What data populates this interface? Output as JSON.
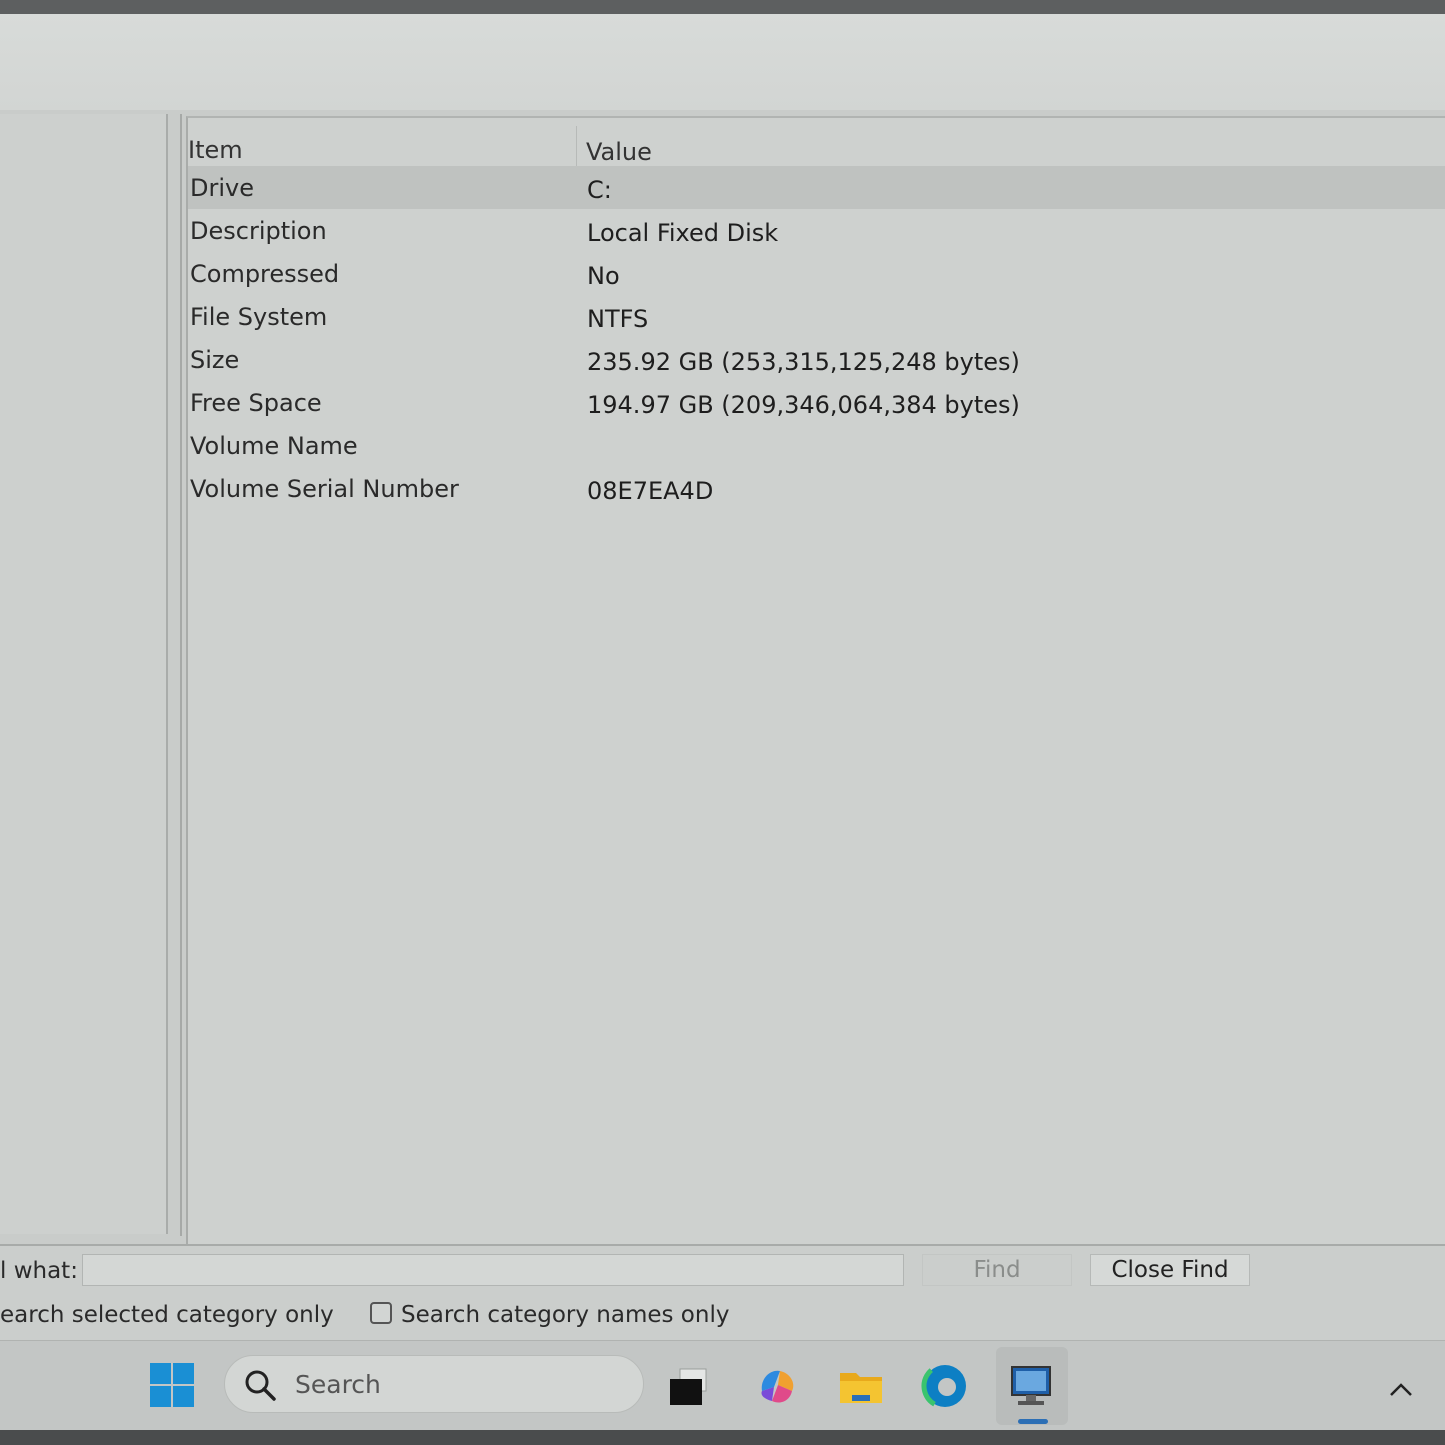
{
  "table": {
    "columns": {
      "item": "Item",
      "value": "Value"
    },
    "rows": [
      {
        "item": "Drive",
        "value": "C:"
      },
      {
        "item": "Description",
        "value": "Local Fixed Disk"
      },
      {
        "item": "Compressed",
        "value": "No"
      },
      {
        "item": "File System",
        "value": "NTFS"
      },
      {
        "item": "Size",
        "value": "235.92 GB (253,315,125,248 bytes)"
      },
      {
        "item": "Free Space",
        "value": "194.97 GB (209,346,064,384 bytes)"
      },
      {
        "item": "Volume Name",
        "value": ""
      },
      {
        "item": "Volume Serial Number",
        "value": "08E7EA4D"
      }
    ]
  },
  "find_bar": {
    "label": "l what:",
    "input_value": "",
    "find_button": "Find",
    "close_button": "Close Find",
    "option_selected_category": "earch selected category only",
    "option_category_names": "Search category names only",
    "option_category_names_checked": false
  },
  "taskbar": {
    "search_placeholder": "Search",
    "icons": [
      "windows-start-icon",
      "task-view-icon",
      "copilot-icon",
      "file-explorer-icon",
      "edge-icon",
      "system-information-icon",
      "chevron-up-icon"
    ]
  },
  "colors": {
    "accent": "#1a8fd4",
    "selected_row": "#bfc2c0"
  }
}
